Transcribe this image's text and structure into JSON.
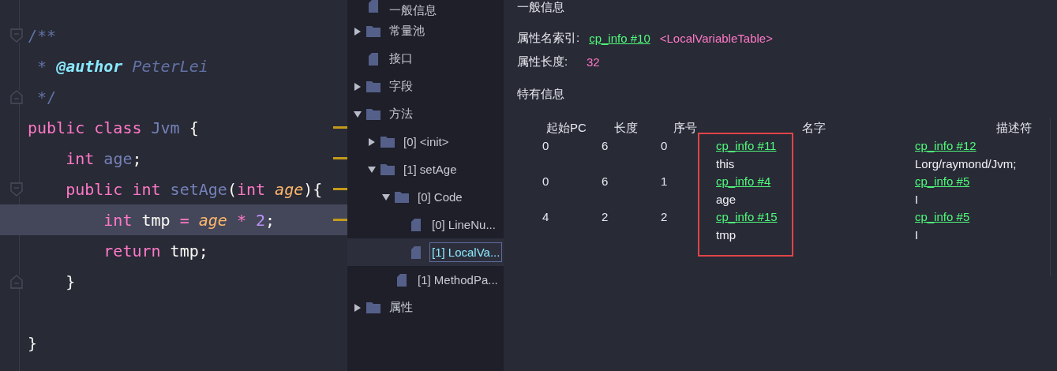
{
  "editor": {
    "lines": [
      {
        "fold_start": true,
        "fold_end": false,
        "marker": false,
        "current": false,
        "tokens": [
          {
            "text": "/**",
            "kind": "comment"
          }
        ]
      },
      {
        "fold_start": false,
        "fold_end": false,
        "marker": false,
        "current": false,
        "tokens": [
          {
            "text": " * ",
            "kind": "comment"
          },
          {
            "text": "@author",
            "kind": "doctag"
          },
          {
            "text": " PeterLei",
            "kind": "docvalue"
          }
        ]
      },
      {
        "fold_start": false,
        "fold_end": true,
        "marker": false,
        "current": false,
        "tokens": [
          {
            "text": " */",
            "kind": "comment"
          }
        ]
      },
      {
        "fold_start": false,
        "fold_end": false,
        "marker": true,
        "current": false,
        "tokens": [
          {
            "text": "public class",
            "kind": "keyword"
          },
          {
            "text": " Jvm",
            "kind": "name"
          },
          {
            "text": " {",
            "kind": "plain"
          }
        ]
      },
      {
        "fold_start": false,
        "fold_end": false,
        "marker": true,
        "current": false,
        "tokens": [
          {
            "text": "    int",
            "kind": "keyword"
          },
          {
            "text": " age",
            "kind": "name"
          },
          {
            "text": ";",
            "kind": "plain"
          }
        ]
      },
      {
        "fold_start": true,
        "fold_end": false,
        "marker": true,
        "current": false,
        "tokens": [
          {
            "text": "    public int",
            "kind": "keyword"
          },
          {
            "text": " setAge",
            "kind": "name"
          },
          {
            "text": "(",
            "kind": "plain"
          },
          {
            "text": "int ",
            "kind": "keyword"
          },
          {
            "text": "age",
            "kind": "param"
          },
          {
            "text": "){",
            "kind": "plain"
          }
        ]
      },
      {
        "fold_start": false,
        "fold_end": false,
        "marker": true,
        "current": true,
        "tokens": [
          {
            "text": "        int",
            "kind": "keyword"
          },
          {
            "text": " tmp",
            "kind": "plain"
          },
          {
            "text": " = ",
            "kind": "keyword"
          },
          {
            "text": "age",
            "kind": "param"
          },
          {
            "text": " *",
            "kind": "keyword"
          },
          {
            "text": " 2",
            "kind": "number"
          },
          {
            "text": ";",
            "kind": "plain"
          }
        ]
      },
      {
        "fold_start": false,
        "fold_end": false,
        "marker": false,
        "current": false,
        "tokens": [
          {
            "text": "        return",
            "kind": "keyword"
          },
          {
            "text": " tmp;",
            "kind": "plain"
          }
        ]
      },
      {
        "fold_start": false,
        "fold_end": true,
        "marker": false,
        "current": false,
        "tokens": [
          {
            "text": "    }",
            "kind": "plain"
          }
        ]
      },
      {
        "fold_start": false,
        "fold_end": false,
        "marker": false,
        "current": false
      },
      {
        "fold_start": false,
        "fold_end": false,
        "marker": false,
        "current": false,
        "tokens": [
          {
            "text": "}",
            "kind": "plain"
          }
        ]
      }
    ]
  },
  "tree": [
    {
      "label": "一般信息",
      "kind": "file",
      "selected": false
    },
    {
      "label": "常量池",
      "kind": "folder",
      "expanded": false,
      "selected": false
    },
    {
      "label": "接口",
      "kind": "file",
      "selected": false
    },
    {
      "label": "字段",
      "kind": "folder",
      "expanded": false,
      "selected": false
    },
    {
      "label": "方法",
      "kind": "folder",
      "expanded": true,
      "selected": false,
      "children": [
        {
          "label": "[0] <init>",
          "kind": "folder",
          "expanded": false,
          "selected": false
        },
        {
          "label": "[1] setAge",
          "kind": "folder",
          "expanded": true,
          "selected": false,
          "children": [
            {
              "label": "[0] Code",
              "kind": "folder",
              "expanded": true,
              "selected": false,
              "children": [
                {
                  "label": "[0] LineNu...",
                  "kind": "file",
                  "selected": false
                },
                {
                  "label": "[1] LocalVa...",
                  "kind": "file",
                  "selected": true
                }
              ]
            },
            {
              "label": "[1] MethodPa...",
              "kind": "file",
              "selected": false
            }
          ]
        }
      ]
    },
    {
      "label": "属性",
      "kind": "folder",
      "expanded": false,
      "selected": false
    }
  ],
  "details": {
    "general_heading": "一般信息",
    "name_index": {
      "label": "属性名索引:",
      "link": "cp_info #10",
      "value": "<LocalVariableTable>"
    },
    "length": {
      "label": "属性长度:",
      "value": "32"
    },
    "specific_heading": "特有信息",
    "table": {
      "columns": [
        "起始PC",
        "长度",
        "序号",
        "名字",
        "描述符"
      ],
      "rows": [
        {
          "start_pc": "0",
          "length": "6",
          "index": "0",
          "name_link": "cp_info #11",
          "name": "this",
          "descriptor_link": "cp_info #12",
          "descriptor": "Lorg/raymond/Jvm;"
        },
        {
          "start_pc": "0",
          "length": "6",
          "index": "1",
          "name_link": "cp_info #4",
          "name": "age",
          "descriptor_link": "cp_info #5",
          "descriptor": "I"
        },
        {
          "start_pc": "4",
          "length": "2",
          "index": "2",
          "name_link": "cp_info #15",
          "name": "tmp",
          "descriptor_link": "cp_info #5",
          "descriptor": "I"
        }
      ]
    }
  }
}
